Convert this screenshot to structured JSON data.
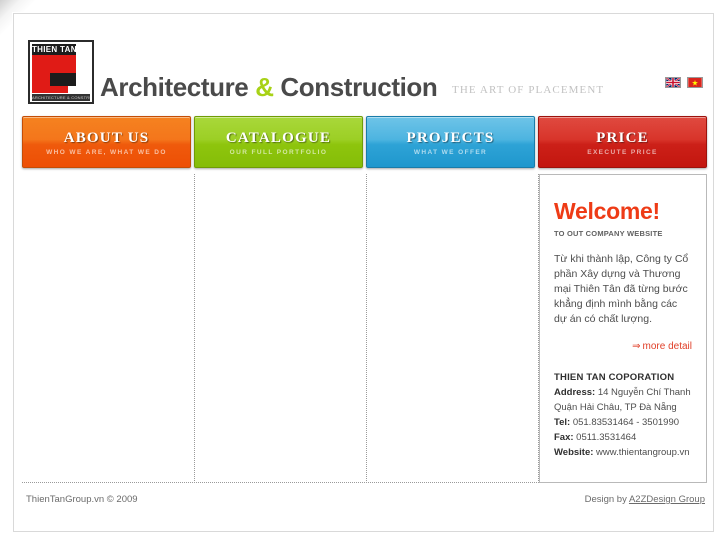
{
  "header": {
    "logo": {
      "name_top": "THIEN TAN",
      "subtitle": "ARCHITECTURE & CONSTRUCTION"
    },
    "brand_part1": "Architecture",
    "brand_amp": "&",
    "brand_part2": "Construction",
    "tagline": "THE ART OF PLACEMENT",
    "languages": [
      {
        "name": "english-flag",
        "title": "English"
      },
      {
        "name": "vietnamese-flag",
        "title": "Tiếng Việt"
      }
    ]
  },
  "nav": {
    "items": [
      {
        "title": "ABOUT US",
        "subtitle": "WHO WE ARE, WHAT WE DO",
        "color": "#ef5a0c"
      },
      {
        "title": "CATALOGUE",
        "subtitle": "OUR FULL PORTFOLIO",
        "color": "#8ec50d"
      },
      {
        "title": "PROJECTS",
        "subtitle": "WHAT WE OFFER",
        "color": "#2ea3d6"
      },
      {
        "title": "PRICE",
        "subtitle": "EXECUTE PRICE",
        "color": "#cc2018"
      }
    ]
  },
  "side_panel": {
    "welcome_title": "Welcome!",
    "welcome_subtitle": "TO OUT COMPANY WEBSITE",
    "welcome_body": "Từ khi thành lập, Công ty Cổ phần Xây dựng và Thương mại Thiên Tân đã từng bước khẳng định mình bằng các dự án có chất lượng.",
    "more_detail": "more detail",
    "more_detail_arrow": "⇒",
    "contact": {
      "company": "THIEN TAN COPORATION",
      "address_label": "Address:",
      "address_line1": " 14 Nguyễn Chí Thanh",
      "address_line2": "Quận Hải Châu, TP Đà Nẵng",
      "tel_label": "Tel:",
      "tel_value": " 051.83531464 - 3501990",
      "fax_label": "Fax:",
      "fax_value": " 0511.3531464",
      "website_label": "Website:",
      "website_value": " www.thientangroup.vn"
    }
  },
  "footer": {
    "copyright": "ThienTanGroup.vn © 2009",
    "design_by": "Design by ",
    "design_link": "A2ZDesign Group"
  },
  "theme": {
    "accent_red": "#ee3b16",
    "accent_green": "#a8d217",
    "text_gray": "#4a4a4a"
  }
}
